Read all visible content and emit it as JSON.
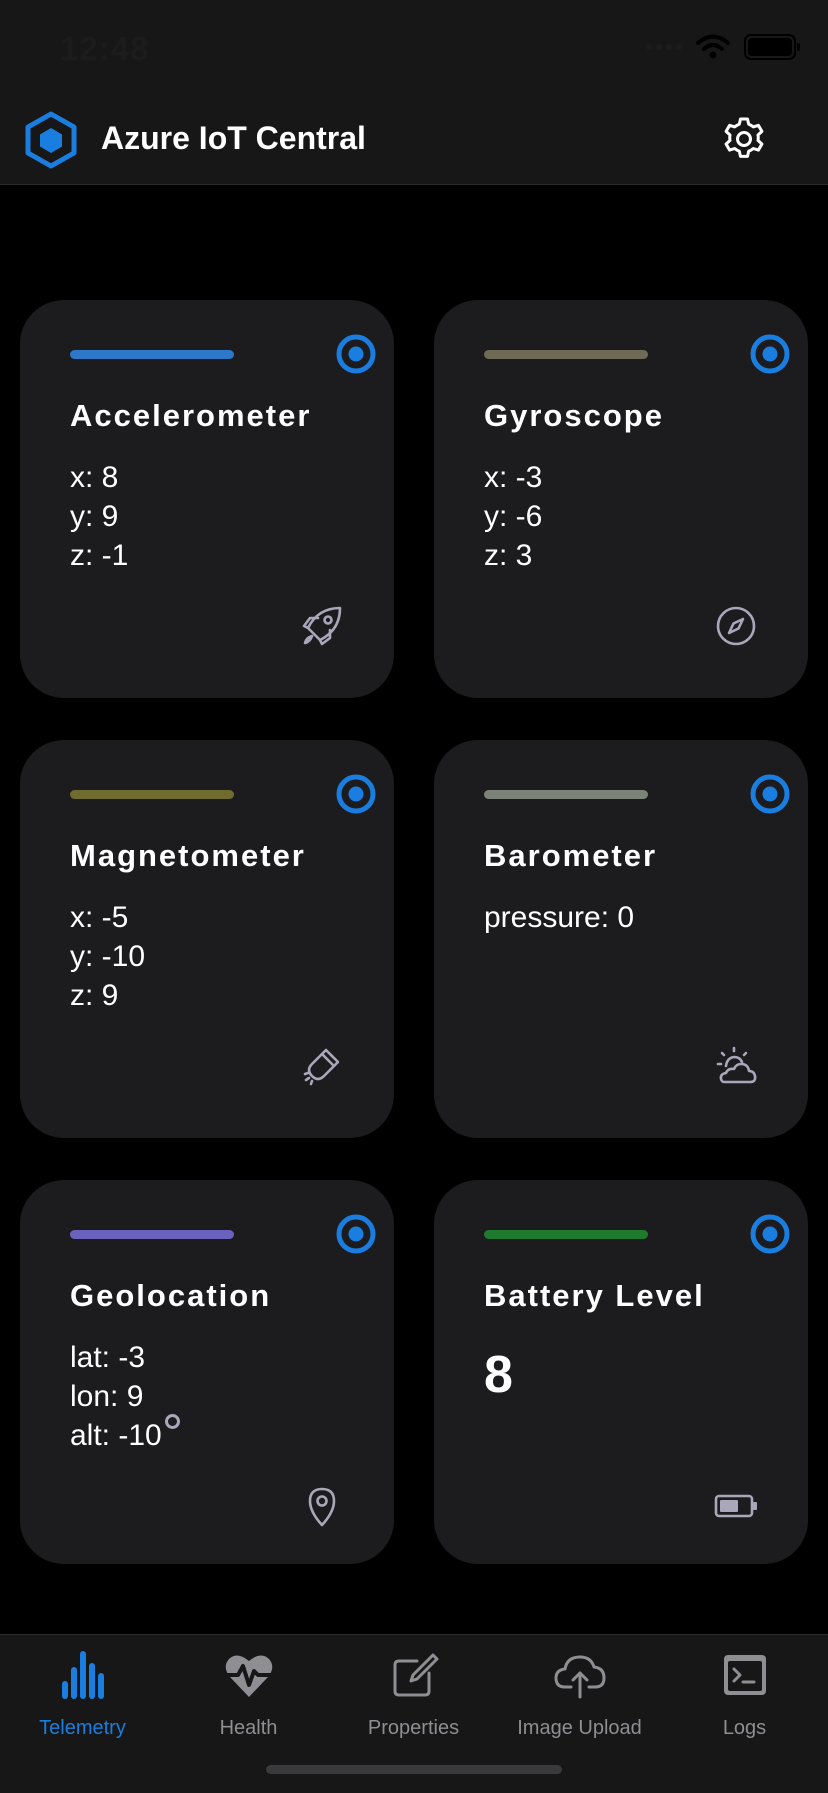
{
  "status_bar": {
    "time": "12:48"
  },
  "header": {
    "title": "Azure IoT Central",
    "logo_icon": "hexagon-logo-icon",
    "settings_icon": "gear-icon"
  },
  "colors": {
    "accent_blue": "#1a7ee0",
    "card_background": "#1c1c1e",
    "icon_gray": "#a9a7b9",
    "tab_inactive": "#8e8e93"
  },
  "cards": [
    {
      "title": "Accelerometer",
      "accent_color": "#2d78c8",
      "values": [
        "x: 8",
        "y: 9",
        "z: -1"
      ],
      "icon": "rocket-icon"
    },
    {
      "title": "Gyroscope",
      "accent_color": "#6e6a55",
      "values": [
        "x: -3",
        "y: -6",
        "z: 3"
      ],
      "icon": "compass-icon"
    },
    {
      "title": "Magnetometer",
      "accent_color": "#6f6c2d",
      "values": [
        "x: -5",
        "y: -10",
        "z: 9"
      ],
      "icon": "magnet-icon"
    },
    {
      "title": "Barometer",
      "accent_color": "#7c8276",
      "values": [
        "pressure: 0"
      ],
      "icon": "cloud-sun-icon"
    },
    {
      "title": "Geolocation",
      "accent_color": "#6a62be",
      "values": [
        "lat: -3",
        "lon: 9",
        "alt: -10"
      ],
      "icon": "map-pin-icon"
    },
    {
      "title": "Battery Level",
      "accent_color": "#1e7a2d",
      "big_value": "8",
      "icon": "battery-icon"
    }
  ],
  "tabs": [
    {
      "label": "Telemetry",
      "icon": "bar-chart-icon",
      "active": true
    },
    {
      "label": "Health",
      "icon": "heart-pulse-icon",
      "active": false
    },
    {
      "label": "Properties",
      "icon": "edit-icon",
      "active": false
    },
    {
      "label": "Image Upload",
      "icon": "cloud-upload-icon",
      "active": false
    },
    {
      "label": "Logs",
      "icon": "terminal-icon",
      "active": false
    }
  ]
}
